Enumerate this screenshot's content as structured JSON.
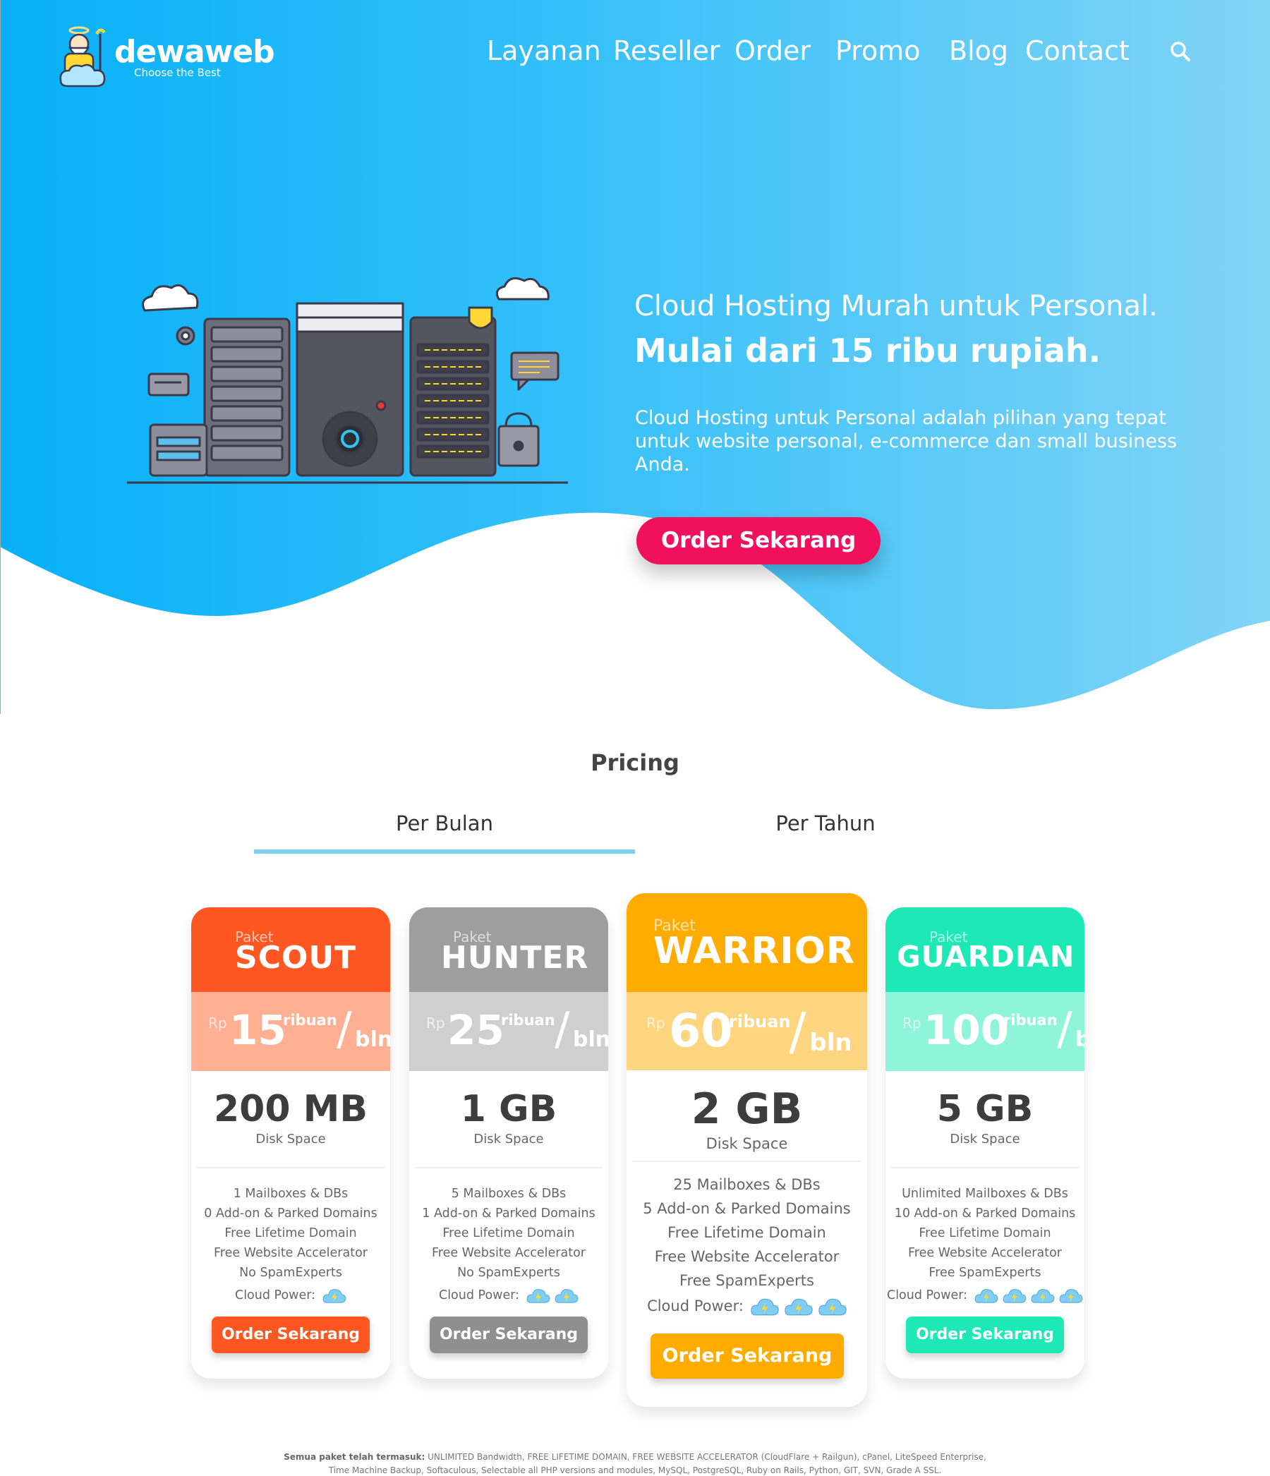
{
  "brand": {
    "name": "dewaweb",
    "tagline": "Choose the Best"
  },
  "nav": {
    "items": [
      "Layanan",
      "Reseller",
      "Order",
      "Promo",
      "Blog",
      "Contact"
    ]
  },
  "hero": {
    "title_line1": "Cloud Hosting Murah untuk Personal.",
    "title_line2": "Mulai dari 15 ribu rupiah.",
    "description": "Cloud Hosting untuk Personal adalah pilihan yang tepat untuk website personal, e-commerce dan small business Anda.",
    "button": "Order Sekarang"
  },
  "pricing": {
    "title": "Pricing",
    "tabs": [
      "Per Bulan",
      "Per Tahun"
    ],
    "active_tab": "Per Bulan",
    "plans": [
      {
        "paket": "Paket",
        "name": "SCOUT",
        "color": "#ff5722",
        "light": "#ffaf92",
        "rp": "Rp",
        "price": "15",
        "unit": "ribuan",
        "slash": "/",
        "per": "bln",
        "disk": "200 MB",
        "disk_label": "Disk Space",
        "features": [
          "1 Mailboxes & DBs",
          "0 Add-on & Parked Domains",
          "Free Lifetime Domain",
          "Free Website Accelerator",
          "No SpamExperts"
        ],
        "cloud_label": "Cloud Power:",
        "cloud_power": 1,
        "button": "Order Sekarang",
        "button_color": "#ff5722"
      },
      {
        "paket": "Paket",
        "name": "HUNTER",
        "color": "#9e9e9e",
        "light": "#cfcfcf",
        "rp": "Rp",
        "price": "25",
        "unit": "ribuan",
        "slash": "/",
        "per": "bln",
        "disk": "1 GB",
        "disk_label": "Disk Space",
        "features": [
          "5 Mailboxes & DBs",
          "1 Add-on & Parked Domains",
          "Free Lifetime Domain",
          "Free Website Accelerator",
          "No SpamExperts"
        ],
        "cloud_label": "Cloud Power:",
        "cloud_power": 2,
        "button": "Order Sekarang",
        "button_color": "#8f8f8f"
      },
      {
        "paket": "Paket",
        "name": "WARRIOR",
        "color": "#ffab00",
        "light": "#ffd580",
        "rp": "Rp",
        "price": "60",
        "unit": "ribuan",
        "slash": "/",
        "per": "bln",
        "disk": "2 GB",
        "disk_label": "Disk Space",
        "features": [
          "25 Mailboxes & DBs",
          "5 Add-on & Parked Domains",
          "Free Lifetime Domain",
          "Free Website Accelerator",
          "Free SpamExperts"
        ],
        "cloud_label": "Cloud Power:",
        "cloud_power": 3,
        "button": "Order Sekarang",
        "button_color": "#ffab00"
      },
      {
        "paket": "Paket",
        "name": "GUARDIAN",
        "color": "#1de9b6",
        "light": "#8ef4da",
        "rp": "Rp",
        "price": "100",
        "unit": "ribuan",
        "slash": "/",
        "per": "bln",
        "disk": "5 GB",
        "disk_label": "Disk Space",
        "features": [
          "Unlimited Mailboxes & DBs",
          "10 Add-on & Parked Domains",
          "Free Lifetime Domain",
          "Free Website Accelerator",
          "Free SpamExperts"
        ],
        "cloud_label": "Cloud Power:",
        "cloud_power": 4,
        "button": "Order Sekarang",
        "button_color": "#1de9b6"
      }
    ]
  },
  "footnote": {
    "bold": "Semua paket telah termasuk:",
    "text": " UNLIMITED Bandwidth, FREE LIFETIME DOMAIN, FREE WEBSITE ACCELERATOR (CloudFlare + Railgun), cPanel, LiteSpeed Enterprise, Time Machine Backup, Softaculous, Selectable all PHP versions and modules, MySQL, PostgreSQL, Ruby on Rails, Python, GIT, SVN, Grade A SSL."
  }
}
